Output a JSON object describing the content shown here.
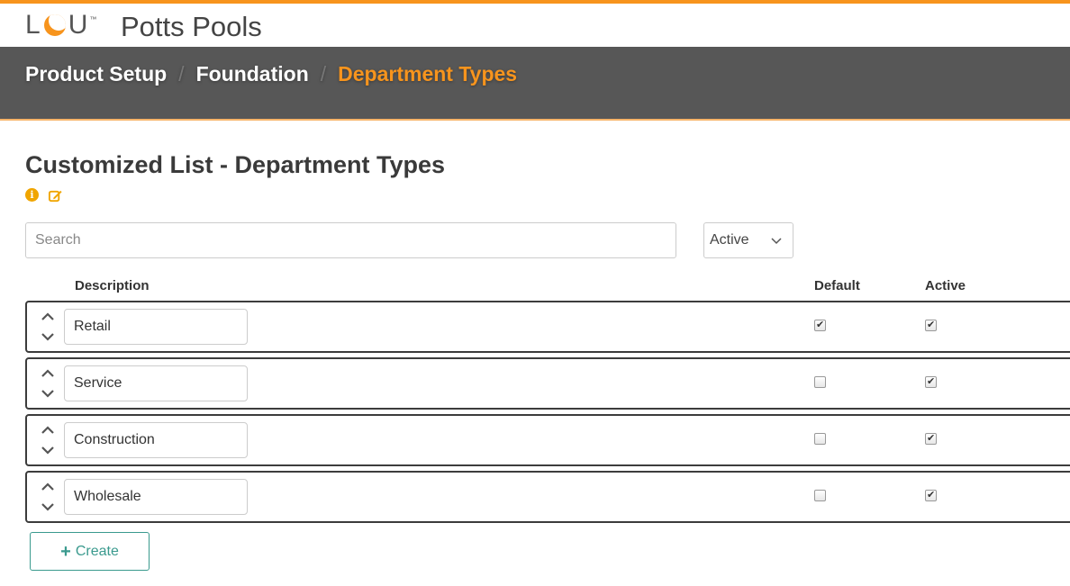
{
  "app": {
    "logo": {
      "l": "L",
      "u": "U",
      "tm": "™"
    },
    "company": "Potts Pools"
  },
  "breadcrumb": {
    "items": [
      "Product Setup",
      "Foundation",
      "Department Types"
    ],
    "separator": "/"
  },
  "page": {
    "title": "Customized List - Department Types",
    "icons": [
      "info-icon",
      "edit-icon"
    ]
  },
  "filters": {
    "search_placeholder": "Search",
    "search_value": "",
    "status_selected": "Active"
  },
  "table": {
    "columns": {
      "description": "Description",
      "default": "Default",
      "active": "Active"
    },
    "rows": [
      {
        "description": "Retail",
        "default": true,
        "active": true
      },
      {
        "description": "Service",
        "default": false,
        "active": true
      },
      {
        "description": "Construction",
        "default": false,
        "active": true
      },
      {
        "description": "Wholesale",
        "default": false,
        "active": true
      }
    ]
  },
  "actions": {
    "create_label": "Create"
  },
  "colors": {
    "accent": "#f7941d",
    "header_bg": "#575757",
    "create": "#3a9a8e"
  }
}
